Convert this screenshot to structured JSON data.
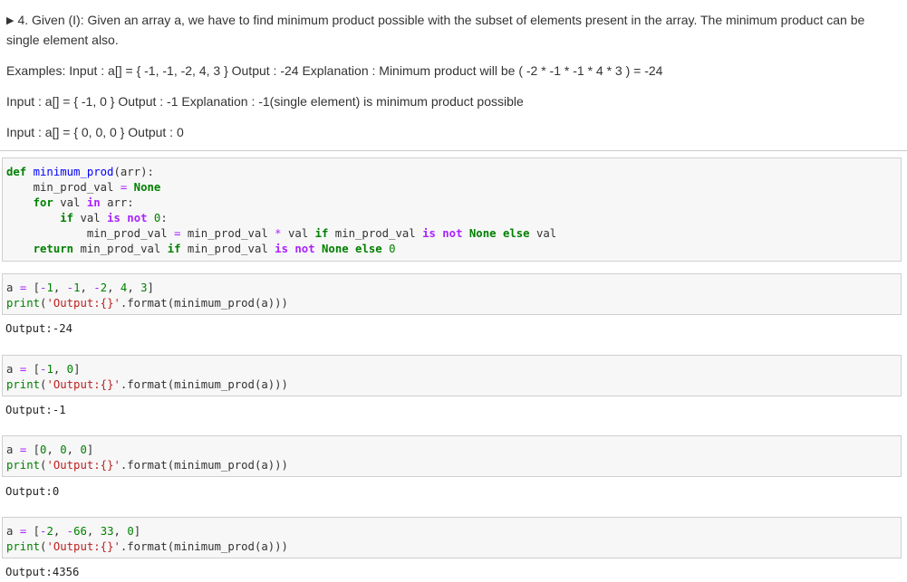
{
  "markdown": {
    "line1": "4. Given (I): Given an array a, we have to find minimum product possible with the subset of elements present in the array. The minimum product can be",
    "line2": "single element also.",
    "line3": "Examples: Input : a[] = { -1, -1, -2, 4, 3 } Output : -24 Explanation : Minimum product will be ( -2 * -1 * -1 * 4 * 3 ) = -24",
    "line4": "Input : a[] = { -1, 0 } Output : -1 Explanation : -1(single element) is minimum product possible",
    "line5": "Input : a[] = { 0, 0, 0 } Output : 0"
  },
  "code_cells": [
    {
      "source": "def minimum_prod(arr):\n    min_prod_val = None\n    for val in arr:\n        if val is not 0:\n            min_prod_val = min_prod_val * val if min_prod_val is not None else val\n    return min_prod_val if min_prod_val is not None else 0"
    },
    {
      "source": "a = [-1, -1, -2, 4, 3]\nprint('Output:{}'.format(minimum_prod(a)))",
      "output": "Output:-24"
    },
    {
      "source": "a = [-1, 0]\nprint('Output:{}'.format(minimum_prod(a)))",
      "output": "Output:-1"
    },
    {
      "source": "a = [0, 0, 0]\nprint('Output:{}'.format(minimum_prod(a)))",
      "output": "Output:0"
    },
    {
      "source": "a = [-2, -66, 33, 0]\nprint('Output:{}'.format(minimum_prod(a)))",
      "output": "Output:4356"
    }
  ]
}
